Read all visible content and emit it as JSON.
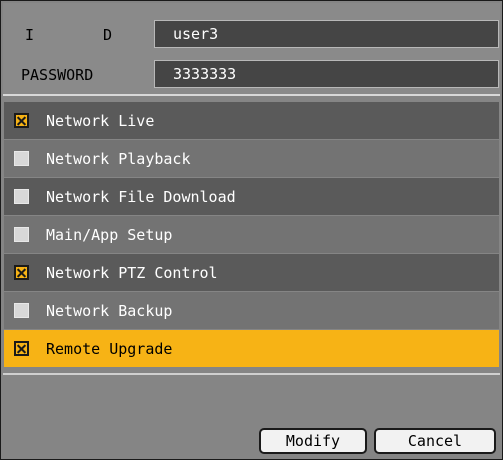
{
  "credentials": {
    "id_label_left": "I",
    "id_label_right": "D",
    "id_value": "user3",
    "password_label": "PASSWORD",
    "password_value": "3333333"
  },
  "permissions": [
    {
      "label": "Network Live",
      "checked": true
    },
    {
      "label": "Network Playback",
      "checked": false
    },
    {
      "label": "Network File Download",
      "checked": false
    },
    {
      "label": "Main/App Setup",
      "checked": false
    },
    {
      "label": "Network PTZ Control",
      "checked": true
    },
    {
      "label": "Network Backup",
      "checked": false
    },
    {
      "label": "Remote Upgrade",
      "checked": true,
      "selected": true
    }
  ],
  "buttons": {
    "modify": "Modify",
    "cancel": "Cancel"
  },
  "colors": {
    "highlight": "#f7b315",
    "row_dark": "#5a5a5a",
    "row_light": "#737373",
    "background": "#858585"
  }
}
